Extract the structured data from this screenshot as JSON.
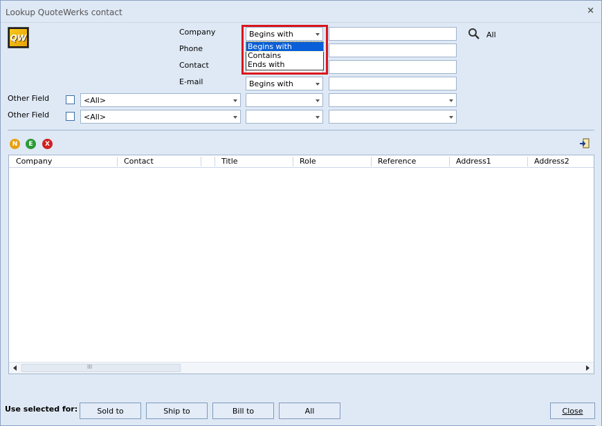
{
  "window": {
    "title": "Lookup QuoteWerks contact",
    "close_glyph": "×"
  },
  "logo": {
    "text": "QW"
  },
  "search_fields": {
    "company_label": "Company",
    "phone_label": "Phone",
    "contact_label": "Contact",
    "email_label": "E-mail",
    "company_match": "Begins with",
    "email_match": "Begins with",
    "all_label": "All"
  },
  "match_dropdown": {
    "options": [
      "Begins with",
      "Contains",
      "Ends with"
    ],
    "selected": "Begins with"
  },
  "other_fields": [
    {
      "label": "Other Field",
      "field_value": "<All>"
    },
    {
      "label": "Other Field",
      "field_value": "<All>"
    }
  ],
  "record_buttons": [
    {
      "letter": "N",
      "color": "#e8a010"
    },
    {
      "letter": "E",
      "color": "#2e9a3a"
    },
    {
      "letter": "X",
      "color": "#d22020"
    }
  ],
  "grid": {
    "columns": [
      "Company",
      "Contact",
      "Title",
      "Role",
      "Reference",
      "Address1",
      "Address2"
    ],
    "scroll_grip": "III"
  },
  "footer": {
    "use_selected_label": "Use selected for:",
    "buttons": [
      "Sold to",
      "Ship to",
      "Bill to",
      "All"
    ],
    "close_label": "Close"
  },
  "colors": {
    "window_bg": "#dfe9f5",
    "highlight": "#d9151c",
    "selected_item": "#0a5fd8"
  }
}
